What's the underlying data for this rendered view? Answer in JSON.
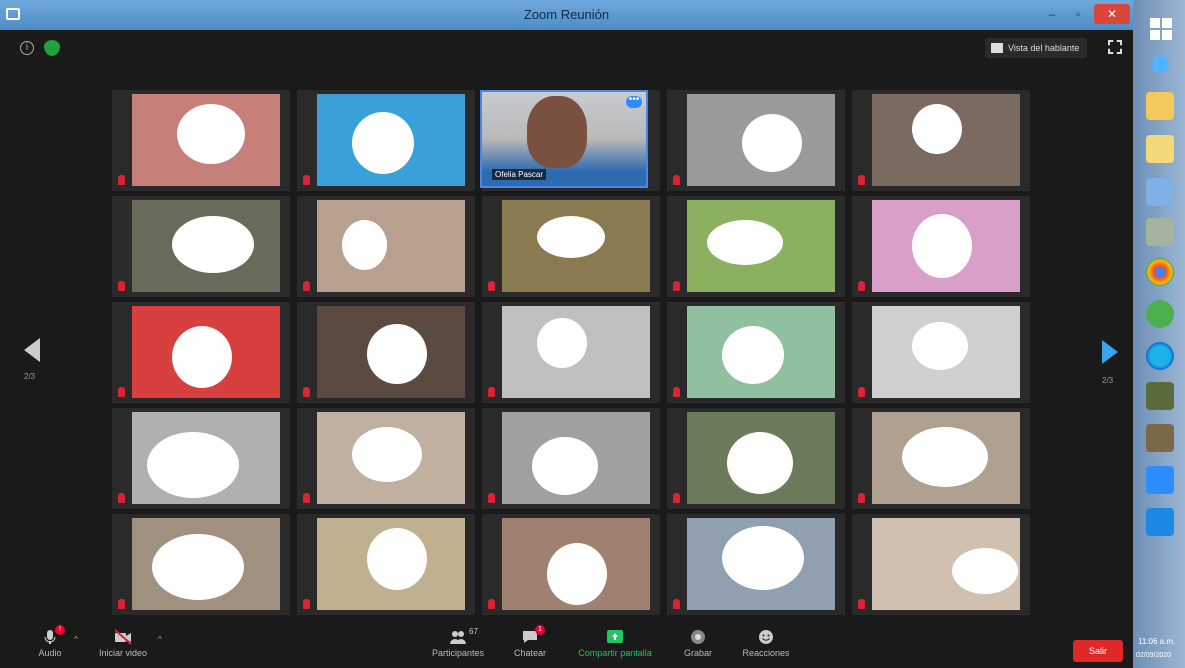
{
  "window": {
    "title": "Zoom Reunión",
    "minimize": "–",
    "maximize": "▫",
    "close": "✕"
  },
  "topbar": {
    "speaker_view_label": "Vista del hablante"
  },
  "nav": {
    "prev_label": "2/3",
    "next_label": "2/3"
  },
  "gallery": {
    "tiles": [
      {
        "name": ""
      },
      {
        "name": ""
      },
      {
        "name": "Ofelia Pascar"
      },
      {
        "name": ""
      },
      {
        "name": ""
      },
      {
        "name": ""
      },
      {
        "name": ""
      },
      {
        "name": ""
      },
      {
        "name": ""
      },
      {
        "name": ""
      },
      {
        "name": ""
      },
      {
        "name": ""
      },
      {
        "name": ""
      },
      {
        "name": ""
      },
      {
        "name": ""
      },
      {
        "name": ""
      },
      {
        "name": ""
      },
      {
        "name": ""
      },
      {
        "name": ""
      },
      {
        "name": ""
      },
      {
        "name": ""
      },
      {
        "name": ""
      },
      {
        "name": ""
      },
      {
        "name": ""
      },
      {
        "name": ""
      }
    ]
  },
  "toolbar": {
    "audio_label": "Audio",
    "video_label": "Iniciar video",
    "participants_label": "Participantes",
    "participants_count": "67",
    "chat_label": "Chatear",
    "share_label": "Compartir pantalla",
    "record_label": "Grabar",
    "reactions_label": "Reacciones",
    "leave_label": "Salir"
  },
  "taskbar": {
    "time": "11:06 a.m.",
    "date": "02/09/2020"
  },
  "colors": {
    "accent": "#2d8cff",
    "share": "#22c55e",
    "leave": "#e02828"
  }
}
